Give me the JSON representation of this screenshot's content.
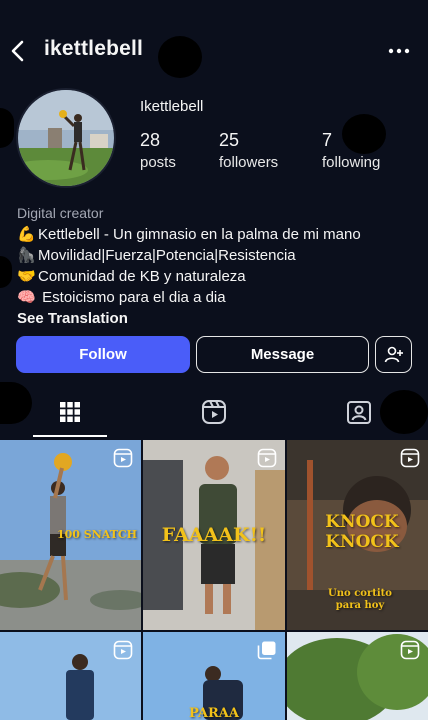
{
  "header": {
    "title": "ikettlebell"
  },
  "profile": {
    "username": "Ikettlebell",
    "stats": [
      {
        "num": "28",
        "label": "posts"
      },
      {
        "num": "25",
        "label": "followers"
      },
      {
        "num": "7",
        "label": "following"
      }
    ],
    "category": "Digital creator",
    "bio": [
      {
        "emoji": "💪",
        "text": "Kettlebell - Un gimnasio en la palma de mi mano"
      },
      {
        "emoji": "🦍",
        "text": "Movilidad|Fuerza|Potencia|Resistencia"
      },
      {
        "emoji": "🤝",
        "text": "Comunidad de KB y naturaleza"
      },
      {
        "emoji": "🧠",
        "text": " Estoicismo para el dia a dia"
      }
    ],
    "see_translation": "See Translation"
  },
  "actions": {
    "follow": "Follow",
    "message": "Message"
  },
  "tabs": {
    "posts_icon": "grid-icon",
    "reels_icon": "reels-icon",
    "tagged_icon": "tagged-icon"
  },
  "grid": {
    "items": [
      {
        "overlay": "100 SNATCH",
        "icon": "reel-icon"
      },
      {
        "overlay": "FAAAAK!!",
        "icon": "reel-icon"
      },
      {
        "overlay": "KNOCK\nKNOCK",
        "overlay2": "Uno cortito\npara hoy",
        "icon": "reel-icon"
      },
      {
        "icon": "reel-icon"
      },
      {
        "overlay": "PARAA",
        "icon": "carousel-icon"
      },
      {
        "icon": "reel-icon"
      }
    ]
  },
  "colors": {
    "background": "#0b0f1c",
    "follow_button": "#4a5df9",
    "overlay_text": "#f2c21a"
  }
}
